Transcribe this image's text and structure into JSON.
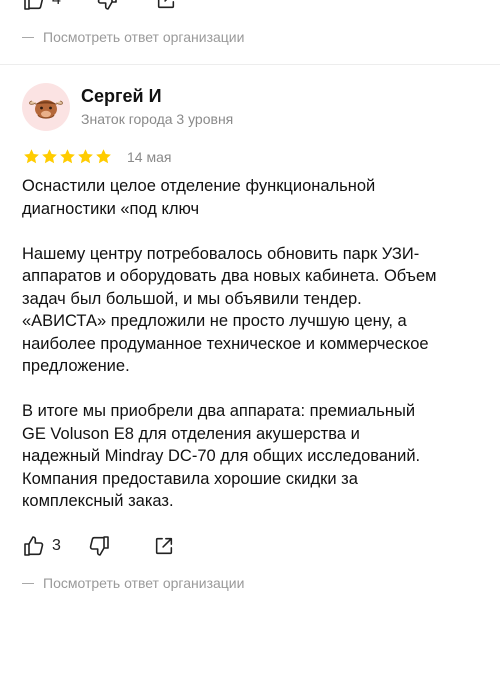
{
  "previous_review": {
    "likes": "4",
    "org_answer_link": "Посмотреть ответ организации"
  },
  "review": {
    "author_name": "Сергей И",
    "author_level": "Знаток города 3 уровня",
    "rating": 5,
    "date": "14 мая",
    "paragraphs": [
      "Оснастили целое отделение функциональной\nдиагностики «под ключ",
      "Нашему центру потребовалось обновить парк УЗИ-\nаппаратов и оборудовать два новых кабинета. Объем\nзадач был большой, и мы объявили тендер.\n«АВИСТА» предложили не просто лучшую цену, а\nнаиболее продуманное техническое и коммерческое\nпредложение.",
      "В итоге мы приобрели два аппарата: премиальный\nGE Voluson E8 для отделения акушерства и\nнадежный Mindray DC-70 для общих исследований.\nКомпания предоставила хорошие скидки за\nкомплексный заказ."
    ],
    "likes": "3",
    "org_answer_link": "Посмотреть ответ организации"
  },
  "colors": {
    "star": "#fc0",
    "muted": "#8a8a8a",
    "avatar_bg": "#fbe3e3"
  }
}
